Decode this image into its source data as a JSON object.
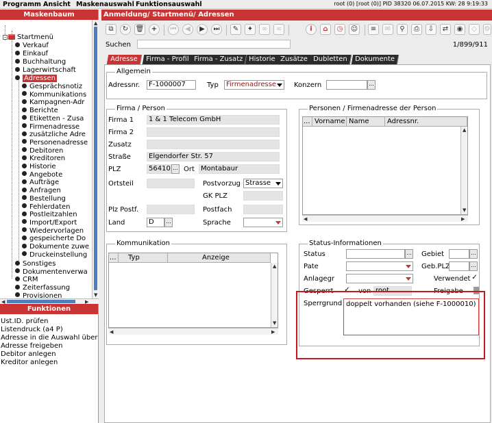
{
  "menu": [
    "Programm",
    "Ansicht",
    "Maskenauswahl",
    "Funktionsauswahl"
  ],
  "status_line": "root (0) [root (0)] PID 38320  06.07.2015 KW: 28  9:19:33",
  "left": {
    "tree_title": "Maskenbaum",
    "root": "Startmenü",
    "level1": [
      "Verkauf",
      "Einkauf",
      "Buchhaltung",
      "Lagerwirtschaft"
    ],
    "selected": "Adressen",
    "children": [
      "Gesprächsnotiz",
      "Kommunikations",
      "Kampagnen-Adr",
      "Berichte",
      "Etiketten - Zusa",
      "Firmenadresse",
      "zusätzliche Adre",
      "Personenadresse",
      "Debitoren",
      "Kreditoren",
      "Historie",
      "Angebote",
      "Aufträge",
      "Anfragen",
      "Bestellung",
      "Fehlerdaten",
      "Postleitzahlen",
      "Import/Export",
      "Wiedervorlagen",
      "gespeicherte Do",
      "Dokumente zuwe",
      "Druckeinstellung"
    ],
    "level1_after": [
      "Sonstiges",
      "Dokumentenverwa",
      "CRM",
      "Zeiterfassung",
      "Provisionen"
    ],
    "funcs_title": "Funktionen",
    "funcs": [
      "Ust.ID. prüfen",
      "Listendruck (a4 P)",
      "Adresse in die Auswahl über",
      "Adresse freigeben",
      "Debitor anlegen",
      "Kreditor anlegen"
    ]
  },
  "main": {
    "title": "Anmeldung/ Startmenü/ Adressen",
    "search_label": "Suchen",
    "counter": "1/899/911",
    "tabs": [
      "Adresse",
      "Firma - Profil",
      "Firma - Zusatz",
      "Historie",
      "Zusätze",
      "Dubletten",
      "Dokumente"
    ],
    "allgemein": {
      "legend": "Allgemein",
      "adressnr_label": "Adressnr.",
      "adressnr": "F-1000007",
      "typ_label": "Typ",
      "typ": "Firmenadresse",
      "konzern_label": "Konzern",
      "konzern": ""
    },
    "firma": {
      "legend": "Firma / Person",
      "firma1_label": "Firma 1",
      "firma1": "1 & 1 Telecom GmbH",
      "firma2_label": "Firma 2",
      "firma2": "",
      "zusatz_label": "Zusatz",
      "zusatz": "",
      "strasse_label": "Straße",
      "strasse": "Elgendorfer Str. 57",
      "plz_label": "PLZ",
      "plz": "56410",
      "ort_label": "Ort",
      "ort": "Montabaur",
      "ortsteil_label": "Ortsteil",
      "ortsteil": "",
      "postvorzug_label": "Postvorzug",
      "postvorzug": "Strasse",
      "gkplz_label": "GK PLZ",
      "gkplz": "",
      "plzpostf_label": "Plz Postf.",
      "plzpostf": "",
      "postfach_label": "Postfach",
      "postfach": "",
      "land_label": "Land",
      "land": "D",
      "sprache_label": "Sprache",
      "sprache": ""
    },
    "personen": {
      "legend": "Personen / Firmenadresse der Person",
      "btn": "...",
      "columns": [
        "Vorname",
        "Name",
        "Adressnr."
      ]
    },
    "kommunikation": {
      "legend": "Kommunikation",
      "btn": "...",
      "columns": [
        "Typ",
        "Anzeige"
      ]
    },
    "statusinfo": {
      "legend": "Status-Informationen",
      "status_label": "Status",
      "status": "",
      "gebiet_label": "Gebiet",
      "gebiet": "",
      "pate_label": "Pate",
      "pate": "",
      "gebplz_label": "Geb.PLZ",
      "gebplz": "",
      "anlagegr_label": "Anlagegr",
      "verwendet_label": "Verwendet",
      "gesperrt_label": "Gesperrt",
      "von_label": "von",
      "von": "root",
      "freigabe_label": "Freigabe",
      "sperrgrund_label": "Sperrgrund",
      "sperrgrund": "doppelt vorhanden (siehe F-1000010)",
      "checkmark": "✓"
    }
  }
}
